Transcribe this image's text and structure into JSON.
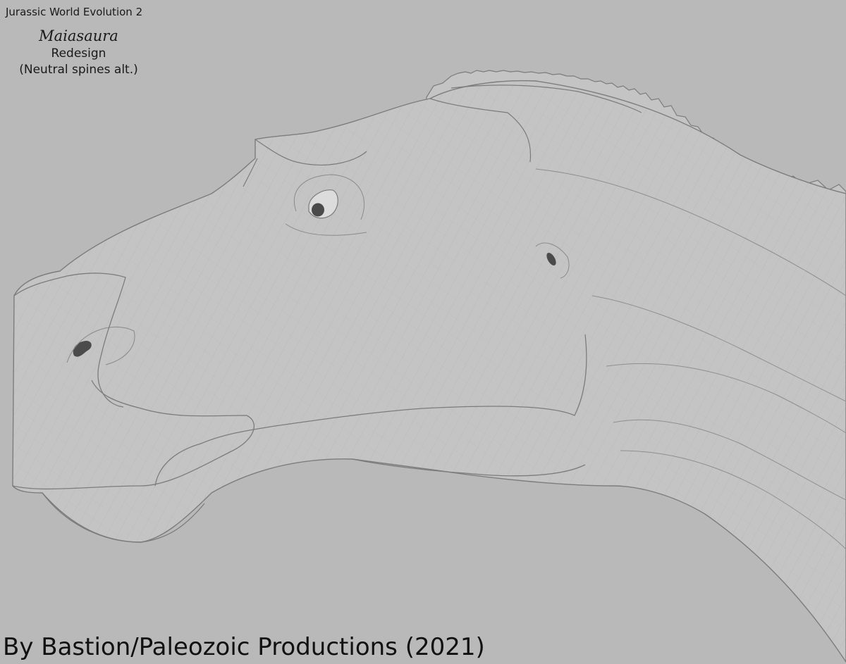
{
  "header": {
    "game_title": "Jurassic World Evolution 2",
    "species": "Maiasaura",
    "line1": "Redesign",
    "line2": "(Neutral spines alt.)"
  },
  "footer": {
    "credit": "By Bastion/Paleozoic Productions (2021)"
  },
  "colors": {
    "background": "#b9b9b9",
    "body_fill": "#c4c4c4",
    "outline": "#7c7c7c",
    "eye_pupil": "#4b4b4b"
  }
}
